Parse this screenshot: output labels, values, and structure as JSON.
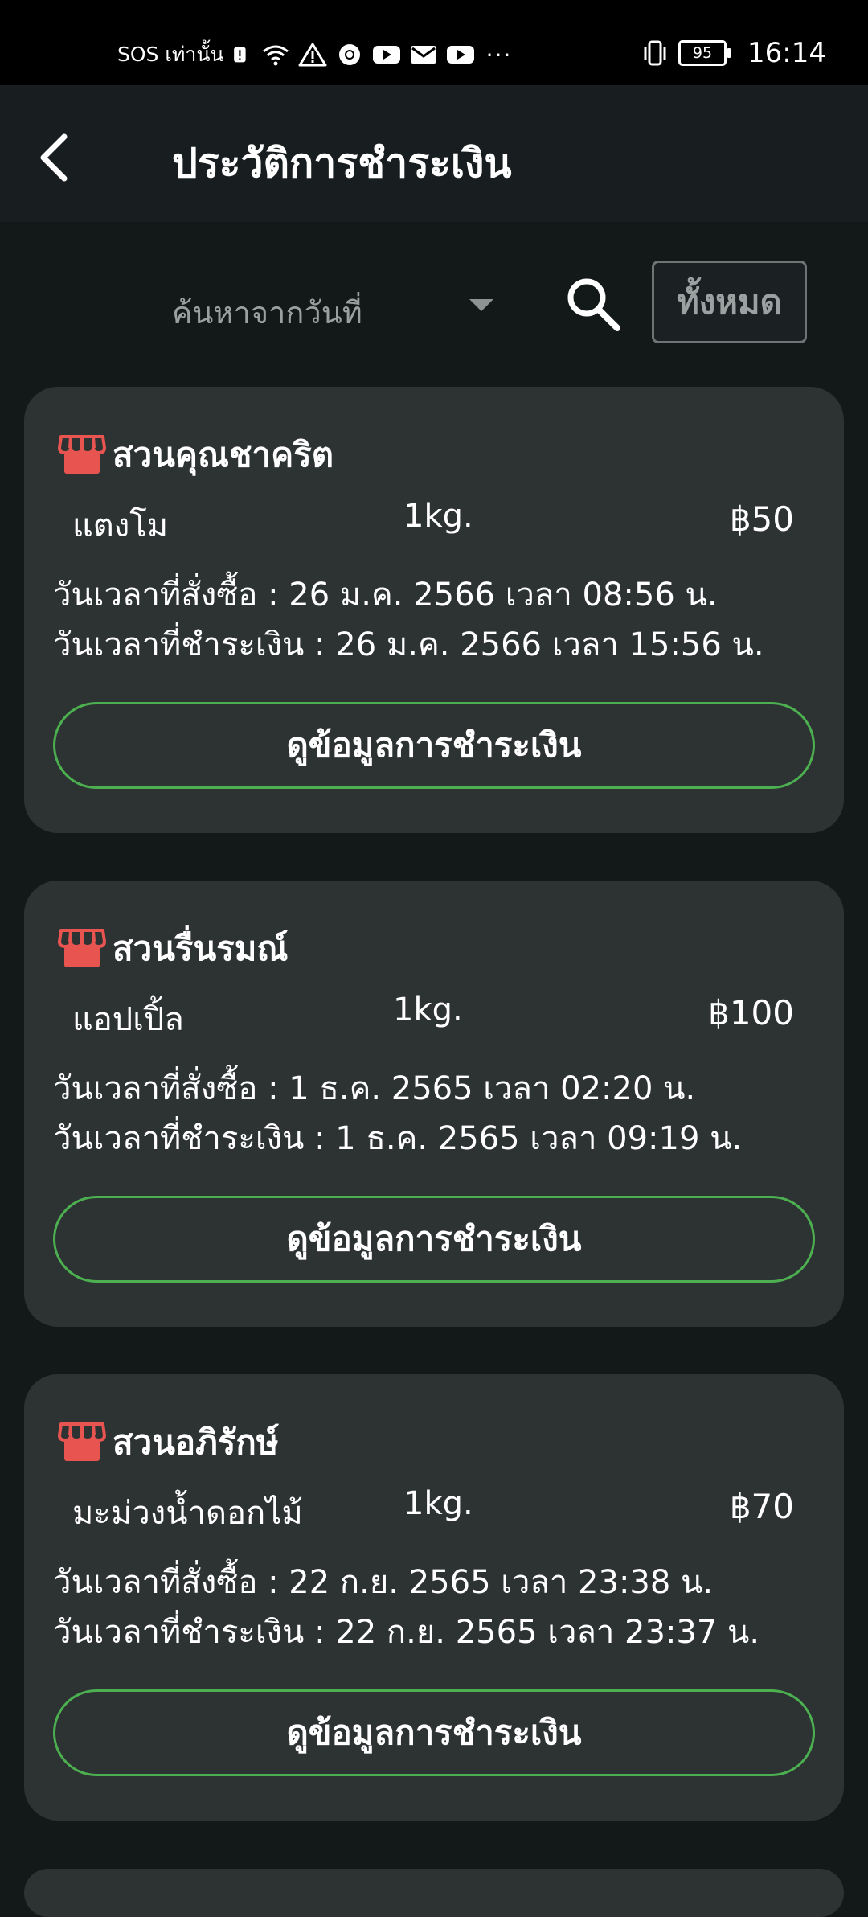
{
  "status_bar": {
    "carrier": "SOS เท่านั้น",
    "battery": "95",
    "time": "16:14",
    "more": "···"
  },
  "header": {
    "title": "ประวัติการชำระเงิน"
  },
  "filter": {
    "date_placeholder": "ค้นหาจากวันที่",
    "all_label": "ทั้งหมด"
  },
  "orders": [
    {
      "shop": "สวนคุณชาคริต",
      "item": "แตงโม",
      "qty": "1kg.",
      "price": "฿50",
      "order_time": "วันเวลาที่สั่งซื้อ : 26 ม.ค. 2566 เวลา 08:56 น.",
      "paid_time": "วันเวลาที่ชำระเงิน : 26 ม.ค. 2566  เวลา 15:56 น.",
      "button": "ดูข้อมูลการชำระเงิน"
    },
    {
      "shop": "สวนรื่นรมณ์",
      "item": "แอปเปิ้ล",
      "qty": "1kg.",
      "price": "฿100",
      "order_time": "วันเวลาที่สั่งซื้อ : 1 ธ.ค. 2565 เวลา 02:20 น.",
      "paid_time": "วันเวลาที่ชำระเงิน : 1 ธ.ค. 2565  เวลา 09:19 น.",
      "button": "ดูข้อมูลการชำระเงิน"
    },
    {
      "shop": "สวนอภิรักษ์",
      "item": "มะม่วงน้ำดอกไม้",
      "qty": "1kg.",
      "price": "฿70",
      "order_time": "วันเวลาที่สั่งซื้อ : 22 ก.ย. 2565 เวลา 23:38 น.",
      "paid_time": "วันเวลาที่ชำระเงิน : 22 ก.ย. 2565  เวลา 23:37 น.",
      "button": "ดูข้อมูลการชำระเงิน"
    }
  ],
  "icons": {
    "back": "chevron-left-icon",
    "search": "search-icon",
    "shop": "storefront-icon"
  },
  "colors": {
    "accent_green": "#4caf50",
    "shop_icon_red": "#e85450",
    "card_bg": "#2d3233",
    "page_bg": "#131819"
  }
}
